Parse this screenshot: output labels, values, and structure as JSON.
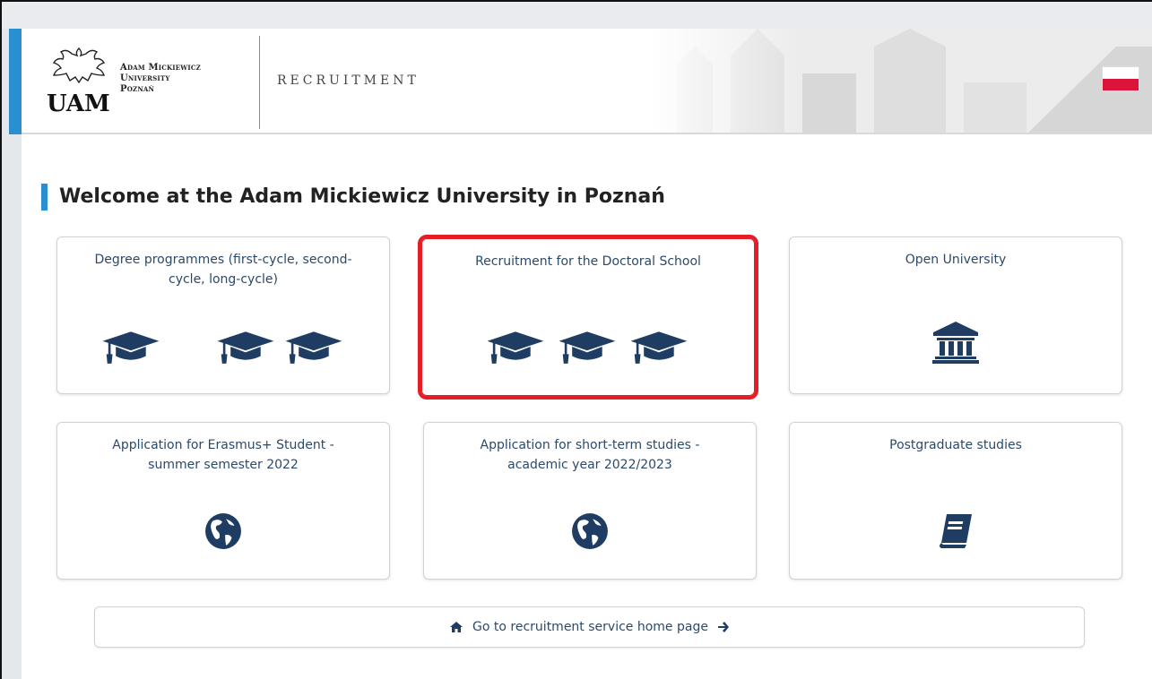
{
  "header": {
    "university_line1": "Adam Mickiewicz",
    "university_line2": "University",
    "university_line3": "Poznań",
    "logo_letters": "UAM",
    "section_title": "RECRUITMENT",
    "language_flag": "poland-flag-icon"
  },
  "page": {
    "title": "Welcome at the Adam Mickiewicz University in Poznań"
  },
  "cards": [
    {
      "label": "Degree programmes (first-cycle, second-cycle, long-cycle)",
      "icon": "graduation-cap-icon",
      "icon_count": 3
    },
    {
      "label": "Recruitment for the Doctoral School",
      "icon": "graduation-cap-icon",
      "icon_count": 3,
      "highlighted": true
    },
    {
      "label": "Open University",
      "icon": "university-building-icon"
    },
    {
      "label": "Application for Erasmus+ Student - summer semester 2022",
      "icon": "globe-icon"
    },
    {
      "label": "Application for short-term studies - academic year 2022/2023",
      "icon": "globe-icon"
    },
    {
      "label": "Postgraduate studies",
      "icon": "book-icon"
    }
  ],
  "home_button": {
    "label": "Go to recruitment service home page",
    "left_icon": "home-icon",
    "right_icon": "arrow-right-icon"
  },
  "colors": {
    "accent": "#2a8fd0",
    "icon_navy": "#1f3d63",
    "highlight": "#e41e26"
  }
}
